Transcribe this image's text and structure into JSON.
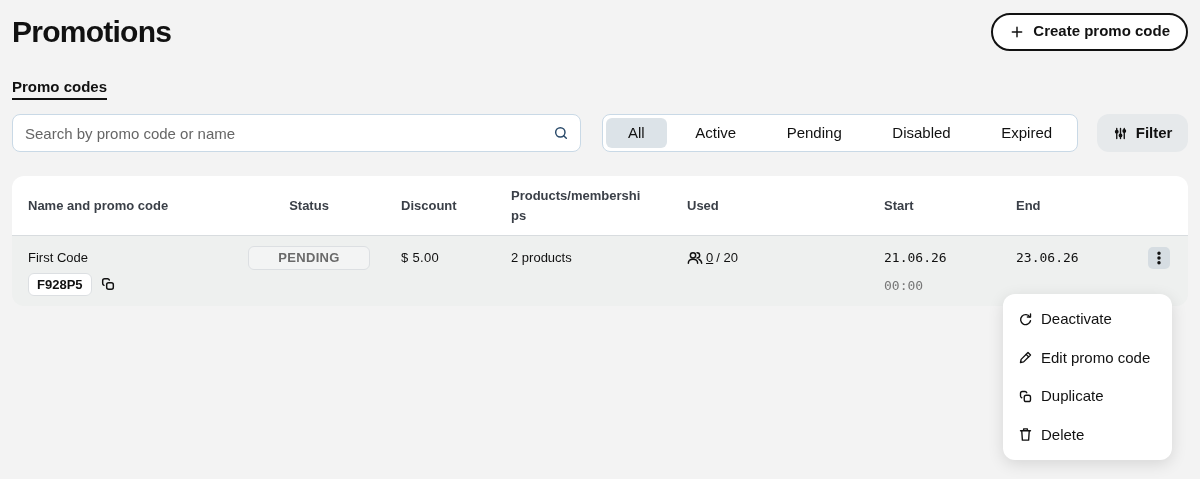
{
  "page": {
    "title": "Promotions",
    "create_button": "Create promo code"
  },
  "tabs": [
    {
      "label": "Promo codes",
      "selected": true
    }
  ],
  "search": {
    "placeholder": "Search by promo code or name"
  },
  "status_filter": [
    {
      "label": "All",
      "selected": true
    },
    {
      "label": "Active",
      "selected": false
    },
    {
      "label": "Pending",
      "selected": false
    },
    {
      "label": "Disabled",
      "selected": false
    },
    {
      "label": "Expired",
      "selected": false
    }
  ],
  "filter_button": "Filter",
  "table": {
    "columns": [
      "Name and promo code",
      "Status",
      "Discount",
      "Products/memberships",
      "Used",
      "Start",
      "End"
    ],
    "rows": [
      {
        "name": "First Code",
        "code": "F928P5",
        "status": "PENDING",
        "discount": "$ 5.00",
        "products": "2 products",
        "used": "0",
        "used_total": "/ 20",
        "start_date": "21.06.26",
        "start_time": "00:00",
        "end_date": "23.06.26",
        "menu_open": true
      }
    ]
  },
  "row_menu": [
    {
      "kind": "refresh",
      "label": "Deactivate"
    },
    {
      "kind": "edit",
      "label": "Edit promo code"
    },
    {
      "kind": "copy",
      "label": "Duplicate"
    },
    {
      "kind": "delete",
      "label": "Delete"
    }
  ]
}
